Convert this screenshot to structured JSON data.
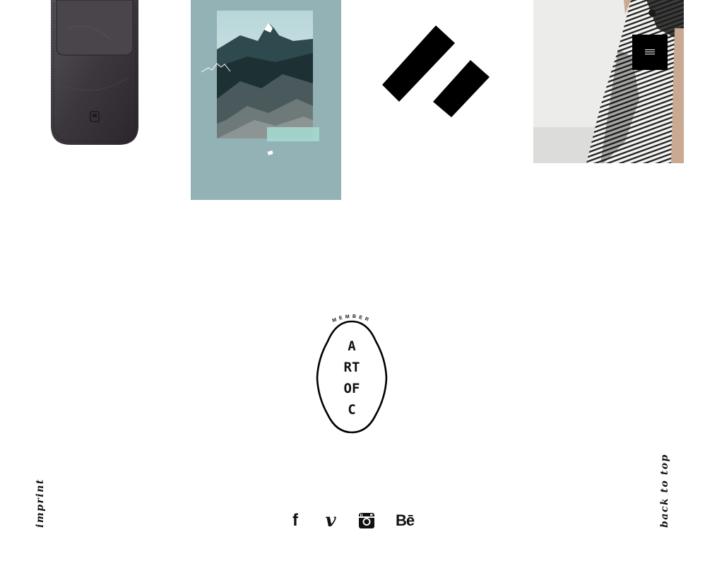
{
  "footer": {
    "imprint_label": "imprint",
    "back_to_top_label": "back to top"
  },
  "badge": {
    "arc_text": "MEMBER",
    "lines": [
      "A",
      "RT",
      "OF",
      "C"
    ]
  },
  "social": [
    {
      "network": "facebook",
      "glyph": "f",
      "icon": "facebook-icon"
    },
    {
      "network": "vimeo",
      "glyph": "v",
      "icon": "vimeo-icon"
    },
    {
      "network": "instagram",
      "glyph": "",
      "icon": "instagram-icon"
    },
    {
      "network": "behance",
      "glyph": "Bē",
      "icon": "behance-icon"
    }
  ],
  "menu": {
    "icon": "hamburger-icon"
  },
  "colors": {
    "poster_teal": "#93b2b5",
    "leather": "#3e393c",
    "ink": "#000000"
  }
}
